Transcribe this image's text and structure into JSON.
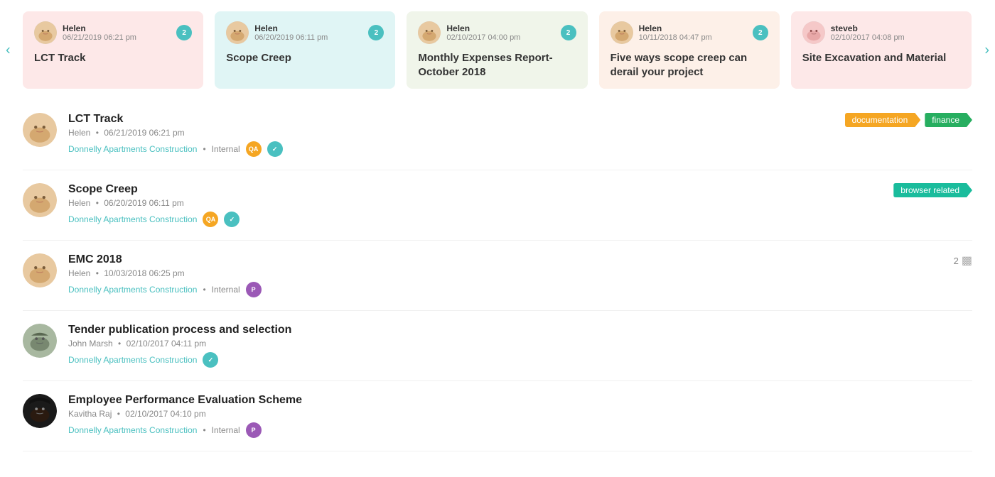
{
  "carousel": {
    "cards": [
      {
        "id": "lct-track",
        "color": "card-pink",
        "user": "Helen",
        "date": "06/21/2019 06:21 pm",
        "badge": "2",
        "title": "LCT Track"
      },
      {
        "id": "scope-creep",
        "color": "card-teal",
        "user": "Helen",
        "date": "06/20/2019 06:11 pm",
        "badge": "2",
        "title": "Scope Creep"
      },
      {
        "id": "monthly-expenses",
        "color": "card-green",
        "user": "Helen",
        "date": "02/10/2017 04:00 pm",
        "badge": "2",
        "title": "Monthly Expenses Report- October 2018"
      },
      {
        "id": "five-ways",
        "color": "card-salmon",
        "user": "Helen",
        "date": "10/11/2018 04:47 pm",
        "badge": "2",
        "title": "Five ways scope creep can derail your project"
      },
      {
        "id": "site-excavation",
        "color": "card-pink",
        "user": "steveb",
        "date": "02/10/2017 04:08 pm",
        "badge": "",
        "title": "Site Excavation and Material"
      }
    ]
  },
  "list": {
    "items": [
      {
        "id": "lct-track-list",
        "title": "LCT Track",
        "author": "Helen",
        "date": "06/21/2019 06:21 pm",
        "project": "Donnelly Apartments Construction",
        "visibility": "Internal",
        "avatars": [
          "QA",
          "✓"
        ],
        "avatar_colors": [
          "bubble-orange",
          "bubble-teal"
        ],
        "tags": [
          {
            "label": "documentation",
            "color": "tag-orange"
          },
          {
            "label": "finance",
            "color": "tag-green"
          }
        ],
        "comment_count": null
      },
      {
        "id": "scope-creep-list",
        "title": "Scope Creep",
        "author": "Helen",
        "date": "06/20/2019 06:11 pm",
        "project": "Donnelly Apartments Construction",
        "visibility": null,
        "avatars": [
          "QA",
          "✓"
        ],
        "avatar_colors": [
          "bubble-orange",
          "bubble-teal"
        ],
        "tags": [
          {
            "label": "browser related",
            "color": "tag-teal"
          }
        ],
        "comment_count": null
      },
      {
        "id": "emc-2018-list",
        "title": "EMC 2018",
        "author": "Helen",
        "date": "10/03/2018 06:25 pm",
        "project": "Donnelly Apartments Construction",
        "visibility": "Internal",
        "avatars": [
          "P"
        ],
        "avatar_colors": [
          "bubble-purple"
        ],
        "tags": [],
        "comment_count": "2"
      },
      {
        "id": "tender-list",
        "title": "Tender publication process and selection",
        "author": "John Marsh",
        "date": "02/10/2017 04:11 pm",
        "project": "Donnelly Apartments Construction",
        "visibility": null,
        "avatars": [
          "✓"
        ],
        "avatar_colors": [
          "bubble-teal"
        ],
        "tags": [],
        "comment_count": null
      },
      {
        "id": "employee-perf-list",
        "title": "Employee Performance Evaluation Scheme",
        "author": "Kavitha Raj",
        "date": "02/10/2017 04:10 pm",
        "project": "Donnelly Apartments Construction",
        "visibility": "Internal",
        "avatars": [
          "P"
        ],
        "avatar_colors": [
          "bubble-purple"
        ],
        "tags": [],
        "comment_count": null
      }
    ]
  },
  "labels": {
    "internal": "Internal",
    "dot": "•"
  }
}
